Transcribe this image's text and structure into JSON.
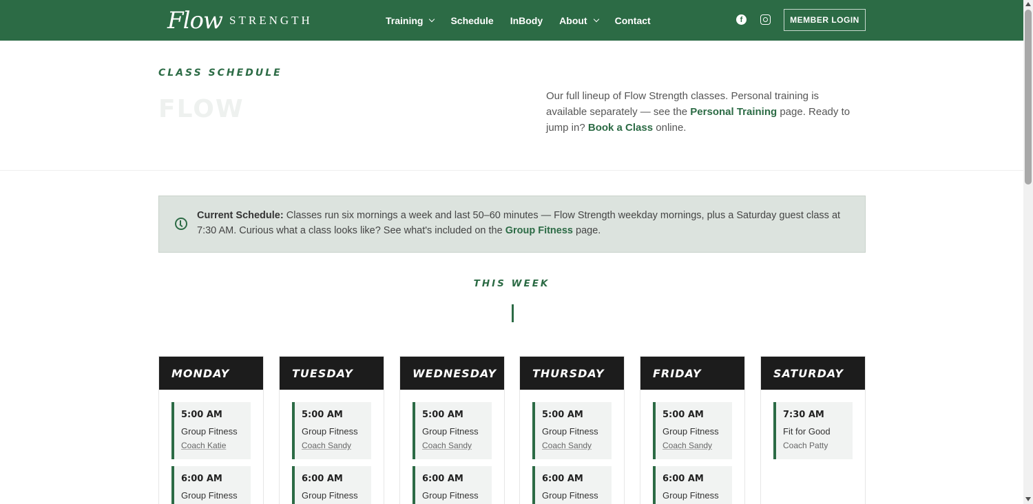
{
  "header": {
    "logo_script": "Flow",
    "logo_word": "STRENGTH",
    "nav": [
      {
        "label": "Training",
        "has_dropdown": true
      },
      {
        "label": "Schedule",
        "has_dropdown": false
      },
      {
        "label": "InBody",
        "has_dropdown": false
      },
      {
        "label": "About",
        "has_dropdown": true
      },
      {
        "label": "Contact",
        "has_dropdown": false
      }
    ],
    "social": [
      "facebook-icon",
      "instagram-icon"
    ],
    "login_label": "MEMBER LOGIN"
  },
  "hero": {
    "eyebrow": "CLASS SCHEDULE",
    "title": "FLOW",
    "intro_part1": "Our full lineup of Flow Strength classes. Personal training is available separately — see the ",
    "intro_link1": "Personal Training",
    "intro_part2": " page. Ready to jump in? ",
    "intro_link2": "Book a Class",
    "intro_part3": " online."
  },
  "notice": {
    "label": "Current Schedule:",
    "text": " Classes run six mornings a week and last 50–60 minutes — Flow Strength weekday mornings, plus a Saturday guest class at 7:30 AM. Curious what a class looks like? See what's included on the ",
    "link": "Group Fitness",
    "text_end": " page."
  },
  "week": {
    "heading": "THIS WEEK"
  },
  "schedule": [
    {
      "day": "MONDAY",
      "slots": [
        {
          "time": "5:00 AM",
          "class": "Group Fitness",
          "coach": "Coach Katie"
        },
        {
          "time": "6:00 AM",
          "class": "Group Fitness",
          "coach": ""
        }
      ]
    },
    {
      "day": "TUESDAY",
      "slots": [
        {
          "time": "5:00 AM",
          "class": "Group Fitness",
          "coach": "Coach Sandy"
        },
        {
          "time": "6:00 AM",
          "class": "Group Fitness",
          "coach": ""
        }
      ]
    },
    {
      "day": "WEDNESDAY",
      "slots": [
        {
          "time": "5:00 AM",
          "class": "Group Fitness",
          "coach": "Coach Sandy"
        },
        {
          "time": "6:00 AM",
          "class": "Group Fitness",
          "coach": ""
        }
      ]
    },
    {
      "day": "THURSDAY",
      "slots": [
        {
          "time": "5:00 AM",
          "class": "Group Fitness",
          "coach": "Coach Sandy"
        },
        {
          "time": "6:00 AM",
          "class": "Group Fitness",
          "coach": ""
        }
      ]
    },
    {
      "day": "FRIDAY",
      "slots": [
        {
          "time": "5:00 AM",
          "class": "Group Fitness",
          "coach": "Coach Sandy"
        },
        {
          "time": "6:00 AM",
          "class": "Group Fitness",
          "coach": ""
        }
      ]
    },
    {
      "day": "SATURDAY",
      "slots": [
        {
          "time": "7:30 AM",
          "class": "Fit for Good",
          "coach": "Coach Patty"
        }
      ]
    }
  ],
  "colors": {
    "brand_green": "#2c6b45",
    "day_header": "#1c1c1c",
    "notice_bg": "#dce3de"
  }
}
